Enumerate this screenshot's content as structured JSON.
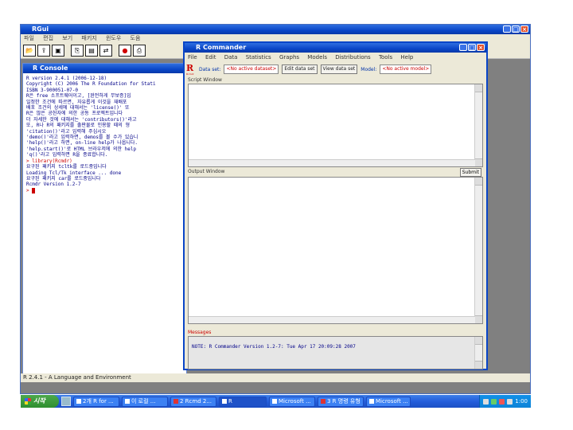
{
  "rgui": {
    "title": "RGui",
    "menu": [
      "파일",
      "편집",
      "보기",
      "패키지",
      "윈도우",
      "도움"
    ],
    "status": "R 2.4.1 - A Language and Environment"
  },
  "console": {
    "title": "R Console",
    "lines": [
      "",
      "R version 2.4.1 (2006-12-18)",
      "Copyright (C) 2006 The R Foundation for Stati",
      "ISBN 3-900051-07-0",
      "",
      "R은 free 소프트웨어이고, [완전하게 무보증]입",
      "일정한 조건에 따르면, 자유롭게 이것을 재배포",
      "배포 조건의 상세에 대해서는 'license()' 또",
      "",
      "R은 많은 공헌자에 의한 공동 프로젝트입니다",
      "더 자세한 것에 대해서는 'contributors()'라고",
      "또, R나 R의 패키지를 출판물로 인용할 때의 형",
      "'citation()'라고 입력해 주십시오",
      "",
      "'demo()'라고 입력하면, demos를 볼 수가 있습니",
      "'help()'라고 하면, on-line help가 나옵니다.",
      "'help.start()'로 HTML 브라우저에 의한 help",
      "'q()'라고 입력하면 R을 종료합니다."
    ],
    "cmd_line": "> library(Rcmdr)",
    "after_lines": [
      "요구된 패키지 tcltk를 로드중입니다",
      "Loading Tcl/Tk interface ... done",
      "요구된 패키지 car를 로드중입니다",
      "",
      "Rcmdr Version 1.2-7",
      ""
    ],
    "prompt": ">"
  },
  "rcmdr": {
    "title": "R Commander",
    "menu": [
      "File",
      "Edit",
      "Data",
      "Statistics",
      "Graphs",
      "Models",
      "Distributions",
      "Tools",
      "Help"
    ],
    "logo": "R",
    "logo_sub": "Rcmdr",
    "dataset_label": "Data set:",
    "dataset_value": "<No active dataset>",
    "edit_dataset": "Edit data set",
    "view_dataset": "View data set",
    "model_label": "Model:",
    "model_value": "<No active model>",
    "script_window_label": "Script Window",
    "output_window_label": "Output Window",
    "submit_label": "Submit",
    "messages_label": "Messages",
    "message_text": "NOTE: R Commander Version 1.2-7: Tue Apr 17 20:09:28 2007"
  },
  "taskbar": {
    "start": "시작",
    "tasks": [
      "2개 R for ...",
      "이 로컬 ...",
      "2 Rcmd 2...",
      "R",
      "Microsoft ...",
      "3 R 명령 유형",
      "Microsoft ..."
    ],
    "time": "1:00"
  }
}
